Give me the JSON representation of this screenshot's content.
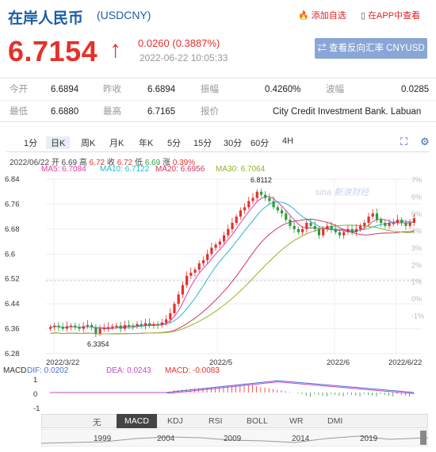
{
  "header": {
    "name": "在岸人民币",
    "code": "(USDCNY)",
    "add_fav": "添加自选",
    "app_view": "在APP中查看"
  },
  "quote": {
    "price": "6.7154",
    "arrow": "↑",
    "change": "0.0260 (0.3887%)",
    "time": "2022-06-22 10:05:33",
    "reverse_button": "⇄ 查看反向汇率 CNYUSD"
  },
  "stats": {
    "open_label": "今开",
    "open": "6.6894",
    "prev_close_label": "昨收",
    "prev_close": "6.6894",
    "amplitude_label": "振幅",
    "amplitude": "0.4260%",
    "volatility_label": "波幅",
    "volatility": "0.0285",
    "low_label": "最低",
    "low": "6.6880",
    "high_label": "最高",
    "high": "6.7165",
    "quoter_label": "报价",
    "quoter": "City Credit Investment Bank. Labuan"
  },
  "tabs": [
    "1分",
    "日K",
    "周K",
    "月K",
    "年K",
    "5分",
    "15分",
    "30分",
    "60分",
    "4H"
  ],
  "active_tab": "日K",
  "ohlc_info": {
    "date": "2022/06/22",
    "open_label": "开",
    "open": "6.69",
    "high_label": "高",
    "high": "6.72",
    "close_label": "收",
    "close": "6.72",
    "low_label": "低",
    "low": "6.69",
    "chg_label": "涨",
    "chg": "0.39%"
  },
  "ma": {
    "ma5": "MA5: 6.7084",
    "ma10": "MA10: 6.7122",
    "ma20": "MA20: 6.6956",
    "ma30": "MA30: 6.7064"
  },
  "colors": {
    "up": "#e4312b",
    "down": "#2a9d3a",
    "ma5": "#e53ca3",
    "ma10": "#23b8d6",
    "ma20": "#d3345f",
    "ma30": "#8fb52c",
    "dif": "#4b6cd8",
    "dea": "#c646c6"
  },
  "chart_labels": {
    "hi_marker": "6.8112",
    "lo_marker": "6.3354",
    "watermark": "sina 新浪财经"
  },
  "price_ticks": [
    "6.84",
    "6.76",
    "6.68",
    "6.6",
    "6.52",
    "6.44",
    "6.36",
    "6.28"
  ],
  "pct_ticks": [
    "7%",
    "6%",
    "5%",
    "4%",
    "3%",
    "2%",
    "1%",
    "0%",
    "-1%"
  ],
  "date_ticks": [
    "2022/3/22",
    "2022/5",
    "2022/6",
    "2022/6/22"
  ],
  "macd": {
    "title": "MACD",
    "dif": "DIF: 0.0202",
    "dea": "DEA: 0.0243",
    "macd": "MACD: -0.0083",
    "ticks": [
      "1",
      "0",
      "-1"
    ]
  },
  "indicators": [
    "无",
    "MACD",
    "KDJ",
    "RSI",
    "BOLL",
    "WR",
    "DMI"
  ],
  "active_indicator": "MACD",
  "nav": [
    "▲",
    "▼"
  ],
  "years": [
    "1999",
    "2004",
    "2009",
    "2014",
    "2019"
  ],
  "chart_data": {
    "type": "candlestick",
    "x": [
      "2022/3/22",
      "2022/5",
      "2022/6",
      "2022/6/22"
    ],
    "ylim": [
      6.28,
      6.84
    ],
    "series": [
      {
        "name": "MA5",
        "value": 6.7084
      },
      {
        "name": "MA10",
        "value": 6.7122
      },
      {
        "name": "MA20",
        "value": 6.6956
      },
      {
        "name": "MA30",
        "value": 6.7064
      }
    ],
    "annotations": [
      {
        "label": "6.8112",
        "kind": "high"
      },
      {
        "label": "6.3354",
        "kind": "low"
      }
    ]
  }
}
